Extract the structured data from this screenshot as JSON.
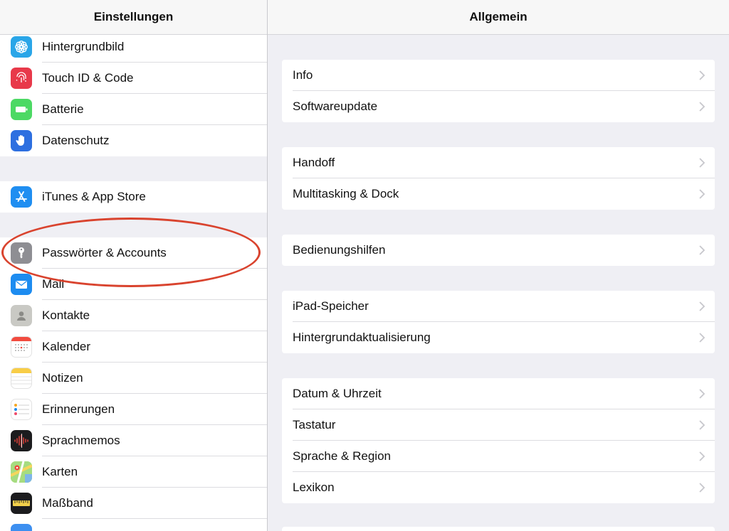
{
  "sidebar": {
    "title": "Einstellungen",
    "groups": [
      {
        "items": [
          {
            "label": "Hintergrundbild",
            "icon": "flower-icon",
            "color": "#2aa6e8"
          },
          {
            "label": "Touch ID & Code",
            "icon": "fingerprint-icon",
            "color": "#e8394a"
          },
          {
            "label": "Batterie",
            "icon": "battery-icon",
            "color": "#4cd964"
          },
          {
            "label": "Datenschutz",
            "icon": "hand-icon",
            "color": "#2d6fe0"
          }
        ]
      },
      {
        "items": [
          {
            "label": "iTunes & App Store",
            "icon": "app-store-icon",
            "color": "#1f8ef1"
          }
        ]
      },
      {
        "items": [
          {
            "label": "Passwörter & Accounts",
            "icon": "key-icon",
            "color": "#8e8e93"
          },
          {
            "label": "Mail",
            "icon": "mail-icon",
            "color": "#1d8cf0"
          },
          {
            "label": "Kontakte",
            "icon": "contacts-icon",
            "color": "#c9c9c4"
          },
          {
            "label": "Kalender",
            "icon": "calendar-icon",
            "color": "#ffffff"
          },
          {
            "label": "Notizen",
            "icon": "notes-icon",
            "color": "#ffffff"
          },
          {
            "label": "Erinnerungen",
            "icon": "reminders-icon",
            "color": "#ffffff"
          },
          {
            "label": "Sprachmemos",
            "icon": "voice-memos-icon",
            "color": "#1c1c1e"
          },
          {
            "label": "Karten",
            "icon": "maps-icon",
            "color": "#8fd36a"
          },
          {
            "label": "Maßband",
            "icon": "measure-icon",
            "color": "#1c1c1e"
          }
        ]
      }
    ]
  },
  "detail": {
    "title": "Allgemein",
    "groups": [
      {
        "items": [
          "Info",
          "Softwareupdate"
        ]
      },
      {
        "items": [
          "Handoff",
          "Multitasking & Dock"
        ]
      },
      {
        "items": [
          "Bedienungshilfen"
        ]
      },
      {
        "items": [
          "iPad-Speicher",
          "Hintergrundaktualisierung"
        ]
      },
      {
        "items": [
          "Datum & Uhrzeit",
          "Tastatur",
          "Sprache & Region",
          "Lexikon"
        ]
      }
    ]
  },
  "annotation": {
    "color": "#d9432e",
    "target": "Passwörter & Accounts"
  }
}
